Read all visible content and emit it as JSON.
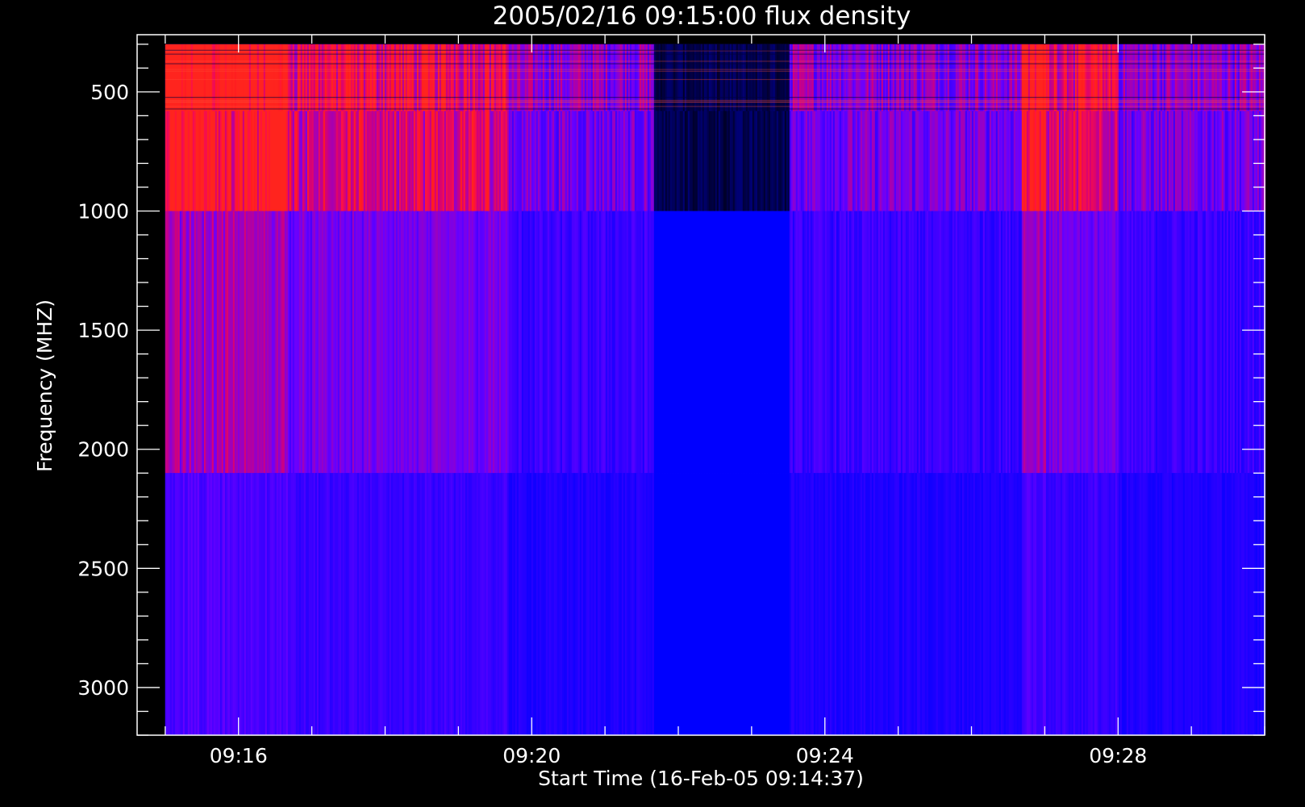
{
  "chart_data": {
    "type": "heatmap",
    "title": "2005/02/16 09:15:00 flux density",
    "xlabel": "Start Time (16-Feb-05 09:14:37)",
    "ylabel": "Frequency (MHZ)",
    "x_range_minutes": [
      "09:14:37",
      "09:30:00"
    ],
    "xlim": [
      "09:14:37",
      "09:30:00"
    ],
    "ylim": [
      3200,
      260
    ],
    "y_axis_inverted": true,
    "data_extent": {
      "time_start": "09:15:00",
      "time_end": "09:30:00",
      "freq_min": 300,
      "freq_max": 3200
    },
    "x_major_ticks": [
      "09:16",
      "09:20",
      "09:24",
      "09:28"
    ],
    "y_major_ticks": [
      500,
      1000,
      1500,
      2000,
      2500,
      3000
    ],
    "y_tick_labels": [
      "500",
      "1000",
      "1500",
      "2000",
      "2500",
      "3000"
    ],
    "x_tick_labels": [
      "09:16",
      "09:20",
      "09:24",
      "09:28"
    ],
    "frequency_bands": [
      {
        "from": 300,
        "to": 580,
        "level": "high-noise"
      },
      {
        "from": 580,
        "to": 1000,
        "level": "high"
      },
      {
        "from": 1000,
        "to": 2100,
        "level": "medium"
      },
      {
        "from": 2100,
        "to": 3200,
        "level": "low"
      }
    ],
    "features": [
      {
        "time_from": "09:15:00",
        "time_to": "09:16:40",
        "level": "strong"
      },
      {
        "time_from": "09:16:40",
        "time_to": "09:19:40",
        "level": "moderate"
      },
      {
        "time_from": "09:21:40",
        "time_to": "09:23:30",
        "level": "weak"
      },
      {
        "time_from": "09:26:40",
        "time_to": "09:27:00",
        "level": "strong"
      },
      {
        "time_from": "09:27:00",
        "time_to": "09:28:00",
        "level": "moderate"
      }
    ],
    "colors": {
      "background": "#000000",
      "axes": "#ffffff",
      "low": "#1010ff",
      "high": "#ff1010",
      "weak": "#000030"
    },
    "grid": false,
    "legend": "none"
  }
}
